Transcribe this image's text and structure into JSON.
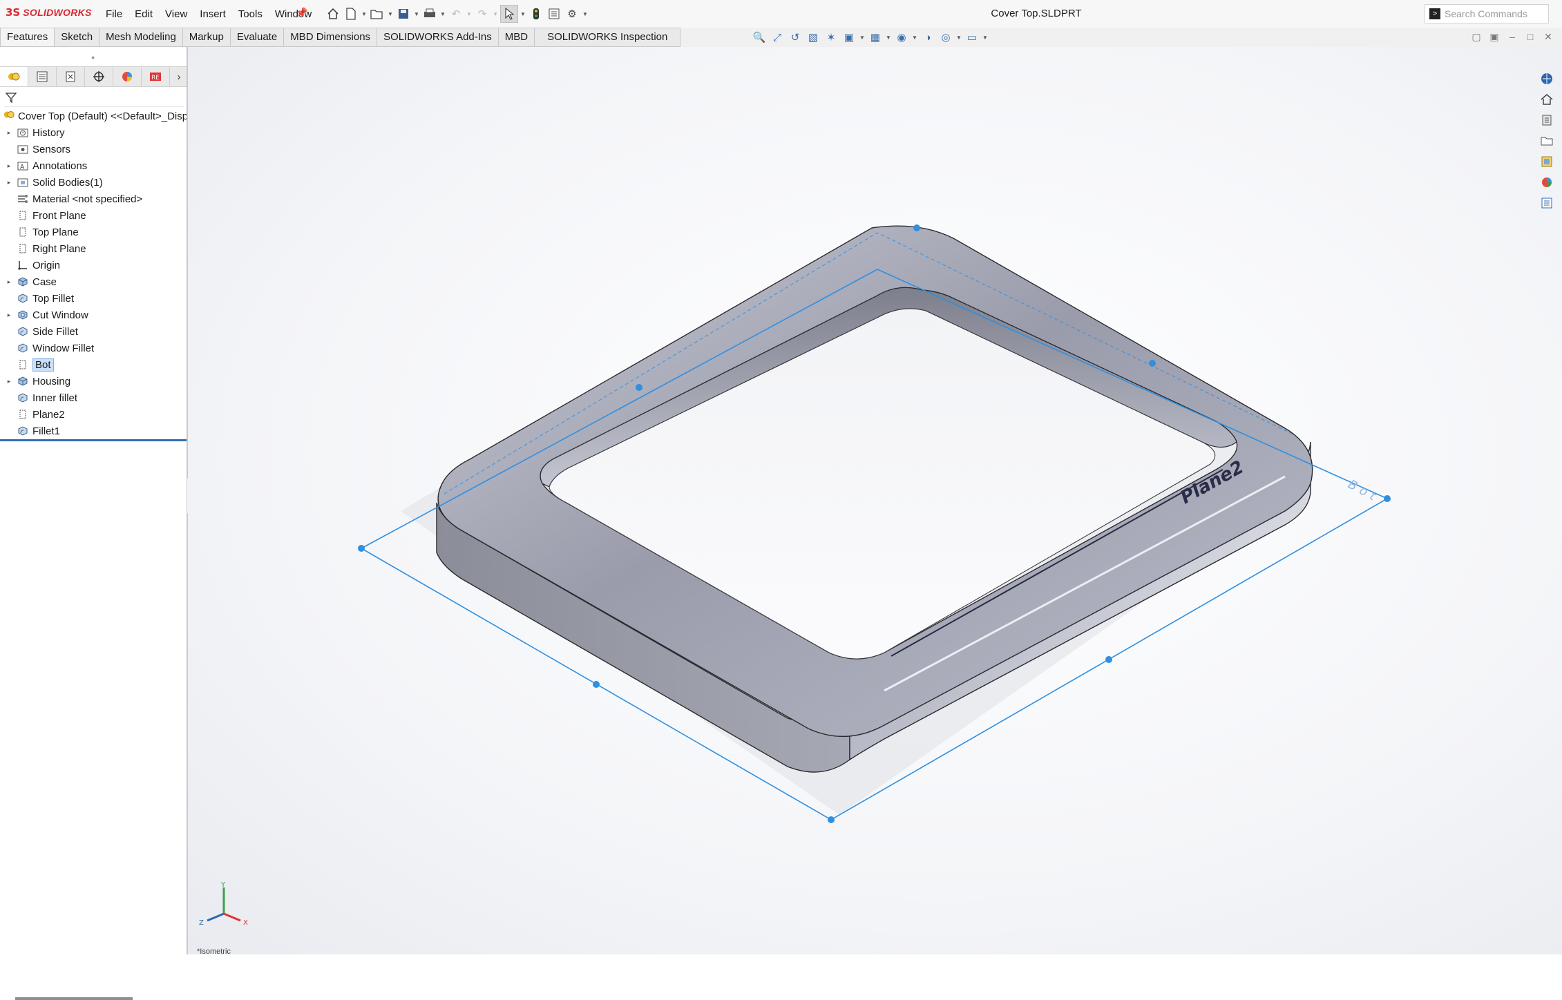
{
  "app": {
    "brand_prefix": "3S",
    "brand": "SOLIDWORKS",
    "document_title": "Cover Top.SLDPRT"
  },
  "menu": [
    "File",
    "Edit",
    "View",
    "Insert",
    "Tools",
    "Window"
  ],
  "search": {
    "placeholder": "Search Commands"
  },
  "command_tabs": [
    "Features",
    "Sketch",
    "Mesh Modeling",
    "Markup",
    "Evaluate",
    "MBD Dimensions",
    "SOLIDWORKS Add-Ins",
    "MBD",
    "SOLIDWORKS Inspection"
  ],
  "feature_tree": {
    "root": "Cover Top (Default) <<Default>_Disp",
    "items": [
      {
        "label": "History",
        "expandable": true,
        "icon": "history-folder-icon"
      },
      {
        "label": "Sensors",
        "expandable": false,
        "icon": "sensors-folder-icon"
      },
      {
        "label": "Annotations",
        "expandable": true,
        "icon": "annotations-folder-icon"
      },
      {
        "label": "Solid Bodies(1)",
        "expandable": true,
        "icon": "solid-bodies-folder-icon"
      },
      {
        "label": "Material <not specified>",
        "expandable": false,
        "icon": "material-icon"
      },
      {
        "label": "Front Plane",
        "expandable": false,
        "icon": "plane-icon"
      },
      {
        "label": "Top Plane",
        "expandable": false,
        "icon": "plane-icon"
      },
      {
        "label": "Right Plane",
        "expandable": false,
        "icon": "plane-icon"
      },
      {
        "label": "Origin",
        "expandable": false,
        "icon": "origin-icon"
      },
      {
        "label": "Case",
        "expandable": true,
        "icon": "feature-icon"
      },
      {
        "label": "Top Fillet",
        "expandable": false,
        "icon": "fillet-icon"
      },
      {
        "label": "Cut Window",
        "expandable": true,
        "icon": "cut-icon"
      },
      {
        "label": "Side Fillet",
        "expandable": false,
        "icon": "fillet-icon"
      },
      {
        "label": "Window Fillet",
        "expandable": false,
        "icon": "fillet-icon"
      },
      {
        "label": "Bot",
        "expandable": false,
        "icon": "plane-icon",
        "selected": true
      },
      {
        "label": "Housing",
        "expandable": true,
        "icon": "feature-icon"
      },
      {
        "label": "Inner fillet",
        "expandable": false,
        "icon": "fillet-icon"
      },
      {
        "label": "Plane2",
        "expandable": false,
        "icon": "plane-icon"
      },
      {
        "label": "Fillet1",
        "expandable": false,
        "icon": "fillet-icon"
      }
    ]
  },
  "viewport": {
    "plane_labels": {
      "plane2": "Plane2",
      "bot": "Bot"
    },
    "triad": {
      "x": "X",
      "y": "Y",
      "z": "Z"
    }
  },
  "status": {
    "bottom_text": "*Isometric"
  },
  "colors": {
    "brand_red": "#d8262f",
    "selection_blue": "#2f8fe0",
    "model_gray": "#8a8c98"
  }
}
